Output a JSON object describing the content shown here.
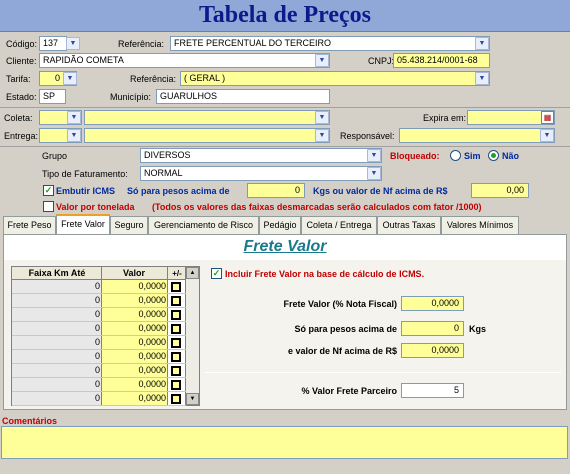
{
  "title": "Tabela de Preços",
  "form": {
    "codigo_label": "Código:",
    "codigo_value": "137",
    "referencia_label": "Referência:",
    "referencia_value": "FRETE PERCENTUAL DO TERCEIRO",
    "cliente_label": "Cliente:",
    "cliente_value": "RAPIDÃO COMETA",
    "cnpj_label": "CNPJ:",
    "cnpj_value": "05.438.214/0001-68",
    "tarifa_label": "Tarifa:",
    "tarifa_value": "0",
    "referencia2_label": "Referência:",
    "referencia2_value": "( GERAL )",
    "estado_label": "Estado:",
    "estado_value": "SP",
    "municipio_label": "Município:",
    "municipio_value": "GUARULHOS",
    "coleta_label": "Coleta:",
    "expira_label": "Expira em:",
    "entrega_label": "Entrega:",
    "responsavel_label": "Responsável:",
    "grupo_label": "Grupo",
    "grupo_value": "DIVERSOS",
    "bloqueado_label": "Bloqueado:",
    "sim_label": "Sim",
    "nao_label": "Não",
    "tipo_label": "Tipo de Faturamento:",
    "tipo_value": "NORMAL",
    "embutir_label": "Embutir ICMS",
    "pesos_label": "Só para pesos acima de",
    "pesos_value": "0",
    "kgs_label": "Kgs ou valor de Nf acima de R$",
    "nf_value": "0,00",
    "tonelada_label": "Valor por tonelada",
    "tonelada_note": "(Todos os valores das faixas desmarcadas serão calculados com fator /1000)"
  },
  "tabs": [
    "Frete Peso",
    "Frete Valor",
    "Seguro",
    "Gerenciamento de Risco",
    "Pedágio",
    "Coleta / Entrega",
    "Outras Taxas",
    "Valores Mínimos"
  ],
  "panel": {
    "heading": "Frete Valor",
    "grid_col1": "Faixa Km Até",
    "grid_col2": "Valor",
    "grid_col3": "+/-",
    "rows": [
      {
        "km": "0",
        "valor": "0,0000"
      },
      {
        "km": "0",
        "valor": "0,0000"
      },
      {
        "km": "0",
        "valor": "0,0000"
      },
      {
        "km": "0",
        "valor": "0,0000"
      },
      {
        "km": "0",
        "valor": "0,0000"
      },
      {
        "km": "0",
        "valor": "0,0000"
      },
      {
        "km": "0",
        "valor": "0,0000"
      },
      {
        "km": "0",
        "valor": "0,0000"
      },
      {
        "km": "0",
        "valor": "0,0000"
      }
    ],
    "incluir_label": "Incluir Frete Valor na base de cálculo de ICMS.",
    "frete_valor_label": "Frete Valor (% Nota Fiscal)",
    "frete_valor_value": "0,0000",
    "pesos_label": "Só para pesos acima de",
    "pesos_value": "0",
    "kgs_label": "Kgs",
    "nf_label": "e valor de Nf acima de R$",
    "nf_value": "0,0000",
    "parceiro_label": "% Valor Frete Parceiro",
    "parceiro_value": "5"
  },
  "comentarios_label": "Comentários",
  "colors": {
    "title": "#0d1a8c",
    "yellow": "#ffff99",
    "accent_red": "#c00000",
    "accent_blue": "#002a9c"
  },
  "icons": [
    "dropdown-arrow-icon",
    "calendar-icon",
    "checkbox-checked-icon",
    "radio-selected-icon"
  ]
}
